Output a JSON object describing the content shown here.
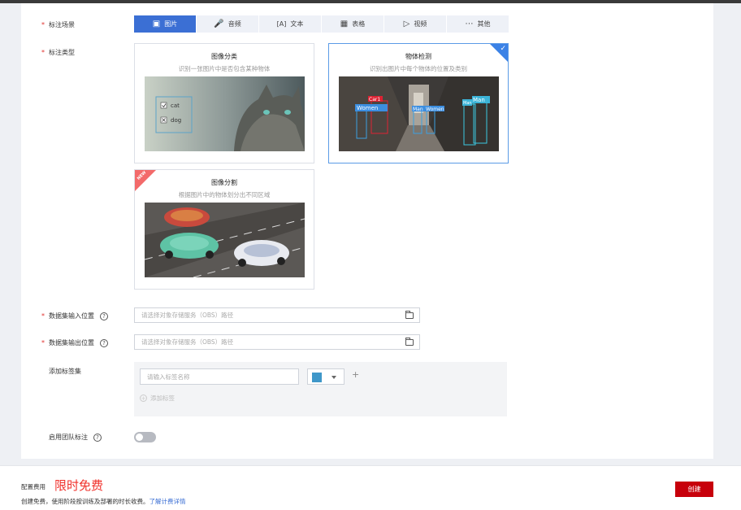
{
  "form": {
    "scene_label": "标注场景",
    "type_label": "标注类型",
    "input_label": "数据集输入位置",
    "output_label": "数据集输出位置",
    "labelset_label": "添加标签集",
    "team_label": "启用团队标注",
    "required_mark": "*",
    "help_glyph": "?"
  },
  "scenes": [
    {
      "label": "图片",
      "icon": "image-icon",
      "active": true
    },
    {
      "label": "音频",
      "icon": "microphone-icon",
      "active": false
    },
    {
      "label": "文本",
      "icon": "text-icon",
      "active": false
    },
    {
      "label": "表格",
      "icon": "table-icon",
      "active": false
    },
    {
      "label": "视频",
      "icon": "video-icon",
      "active": false
    },
    {
      "label": "其他",
      "icon": "more-icon",
      "active": false
    }
  ],
  "types": [
    {
      "title": "图像分类",
      "desc": "识别一张图片中是否包含某种物体",
      "selected": false,
      "badge": "",
      "options": [
        "cat",
        "dog"
      ]
    },
    {
      "title": "物体检测",
      "desc": "识别出图片中每个物体的位置及类别",
      "selected": true,
      "badge": "",
      "boxes": [
        "Car1",
        "Women",
        "Man",
        "Women",
        "Man",
        "Man"
      ]
    },
    {
      "title": "图像分割",
      "desc": "根据图片中的物体划分出不同区域",
      "selected": false,
      "badge": "NEW"
    }
  ],
  "inputs": {
    "input_placeholder": "请选择对象存储服务（OBS）路径",
    "output_placeholder": "请选择对象存储服务（OBS）路径",
    "label_name_placeholder": "请输入标签名称",
    "add_label_text": "添加标签",
    "add_glyph": "+"
  },
  "colors": {
    "accent": "#3b6fd4",
    "label_swatch": "#3f97c9",
    "required": "#e0312e",
    "create_button": "#c7000b"
  },
  "team_enabled": false,
  "footer": {
    "fee_label": "配置费用",
    "fee_value": "限时免费",
    "note_prefix": "创建免费，使用阶段按训练及部署的时长收费。",
    "note_link": "了解计费详情",
    "create_label": "创建"
  }
}
